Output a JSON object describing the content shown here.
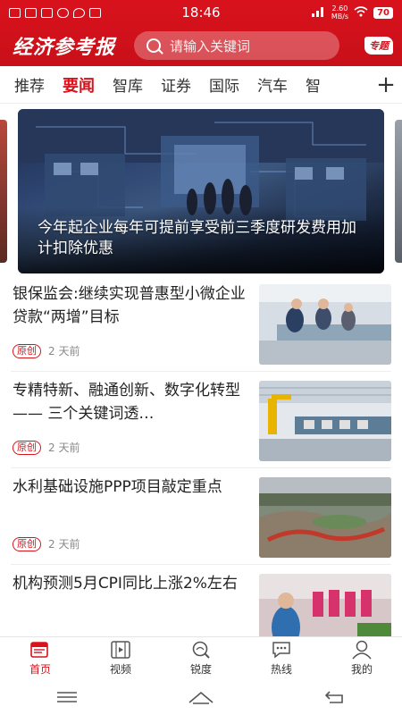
{
  "status": {
    "time": "18:46",
    "net_speed_value": "2.60",
    "net_speed_unit": "MB/s",
    "battery": "70"
  },
  "header": {
    "logo": "经济参考报",
    "search_placeholder": "请输入关键词",
    "special_label": "专题"
  },
  "tabs": [
    "推荐",
    "要闻",
    "智库",
    "证券",
    "国际",
    "汽车",
    "智"
  ],
  "active_tab": "要闻",
  "banner": {
    "caption": "今年起企业每年可提前享受前三季度研发费用加计扣除优惠"
  },
  "news": [
    {
      "title": "银保监会:继续实现普惠型小微企业贷款“两增”目标",
      "tag": "原创",
      "time": "2 天前"
    },
    {
      "title": "专精特新、融通创新、数字化转型—— 三个关键词透…",
      "tag": "原创",
      "time": "2 天前"
    },
    {
      "title": "水利基础设施PPP项目敲定重点",
      "tag": "原创",
      "time": "2 天前"
    },
    {
      "title": "机构预测5月CPI同比上涨2%左右",
      "tag": "",
      "time": ""
    }
  ],
  "tabbar": [
    {
      "label": "首页",
      "icon": "news-home-icon",
      "active": true
    },
    {
      "label": "视频",
      "icon": "video-icon",
      "active": false
    },
    {
      "label": "锐度",
      "icon": "search-magnifier-icon",
      "active": false
    },
    {
      "label": "热线",
      "icon": "chat-hotline-icon",
      "active": false
    },
    {
      "label": "我的",
      "icon": "user-icon",
      "active": false
    }
  ],
  "colors": {
    "brand": "#d9121c"
  }
}
